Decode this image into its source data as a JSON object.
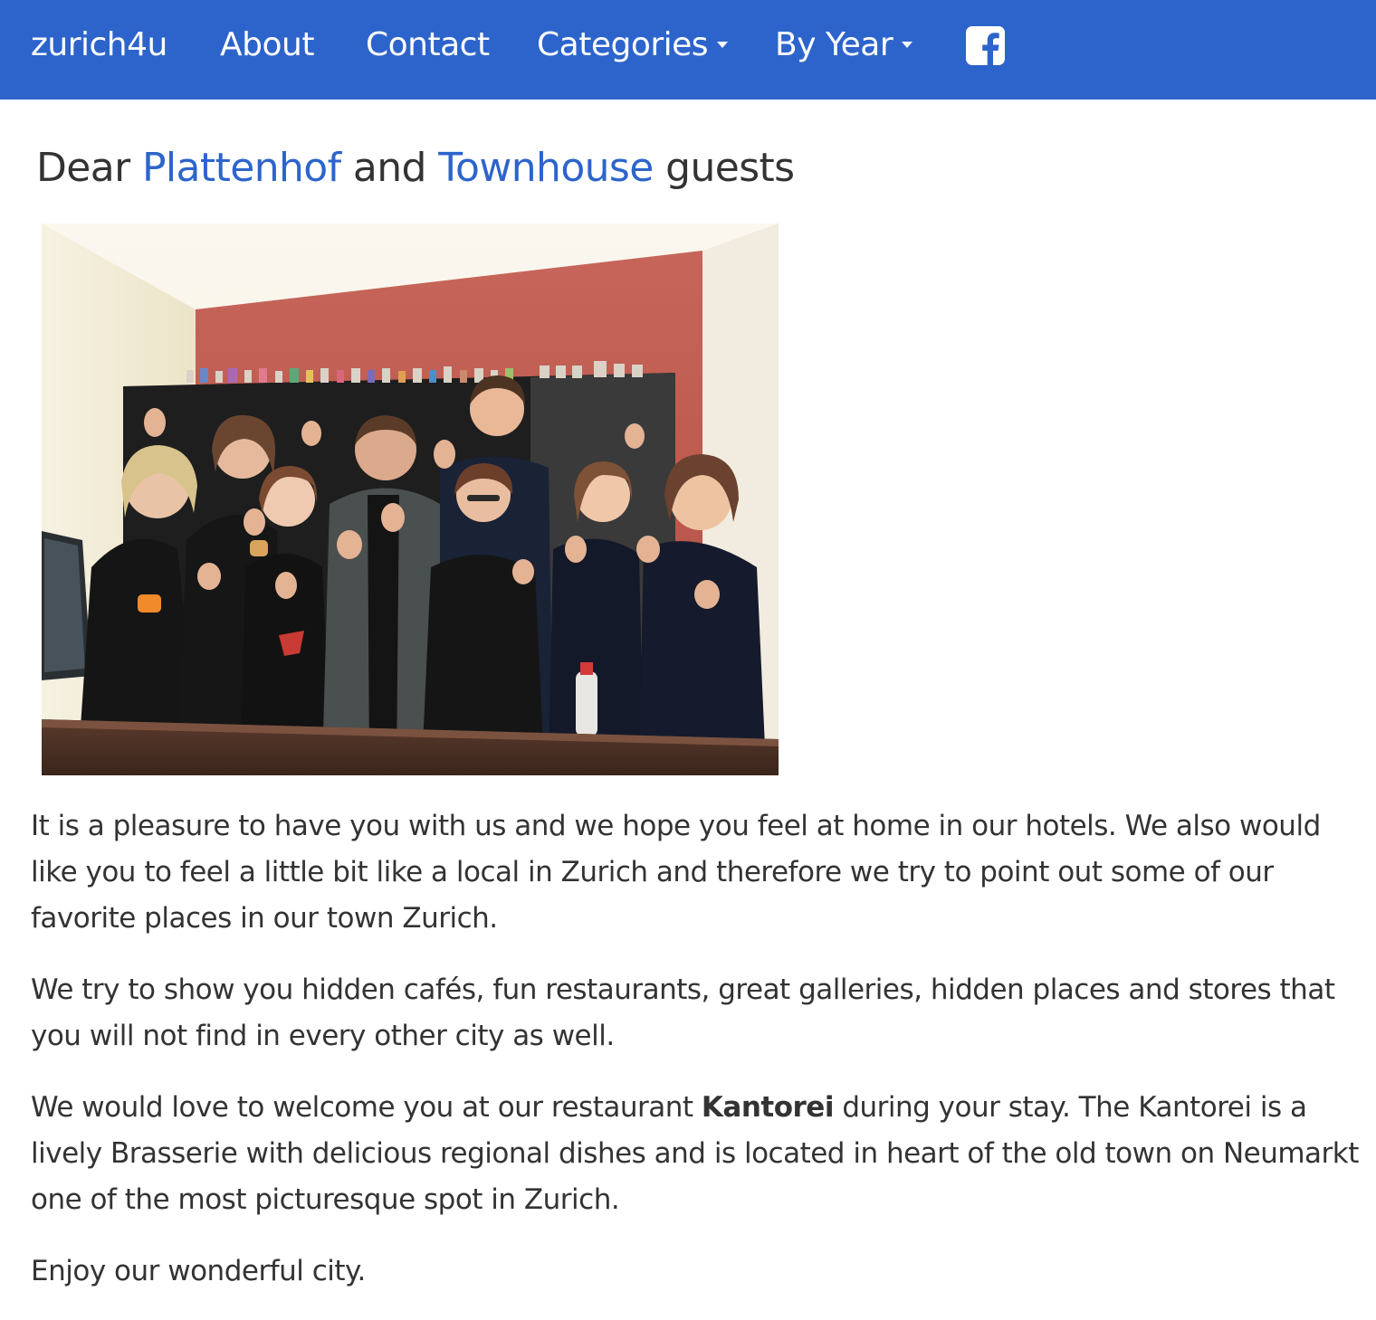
{
  "nav": {
    "brand": "zurich4u",
    "about": "About",
    "contact": "Contact",
    "categories": "Categories",
    "by_year": "By Year",
    "facebook_icon": "facebook-icon"
  },
  "headline": {
    "dear": "Dear ",
    "link1": "Plattenhof",
    "and": " and ",
    "link2": "Townhouse",
    "guests": " guests"
  },
  "paragraphs": {
    "p1": "It is a pleasure to have you with us and we hope you feel at home in our hotels. We also would like you to feel a little bit like a local in Zurich and therefore we try to point out some of our favorite places in our town Zurich.",
    "p2": "We try to show you hidden cafés, fun restaurants, great galleries, hidden places and stores that you will not find in every other city as well.",
    "p3_start": "We would love to welcome you at our restaurant ",
    "p3_bold": "Kantorei",
    "p3_end": " during your stay. The Kantorei is a lively Brasserie with delicious regional dishes and is located in heart of the old town on Neumarkt one of the most picturesque spot in Zurich.",
    "p4": "Enjoy our wonderful city."
  },
  "colors": {
    "navbar": "#2d64cc",
    "link": "#2d64cc",
    "text": "#333333"
  }
}
